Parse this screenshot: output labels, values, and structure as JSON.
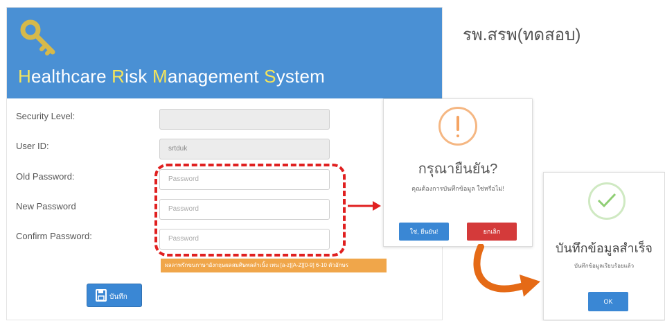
{
  "header": {
    "title_parts": [
      {
        "text": "H",
        "hl": true
      },
      {
        "text": "ealthcare ",
        "hl": false
      },
      {
        "text": "R",
        "hl": true
      },
      {
        "text": "isk ",
        "hl": false
      },
      {
        "text": "M",
        "hl": true
      },
      {
        "text": "anagement ",
        "hl": false
      },
      {
        "text": "S",
        "hl": true
      },
      {
        "text": "ystem",
        "hl": false
      }
    ]
  },
  "hospital_name": "รพ.สรพ(ทดสอบ)",
  "form": {
    "security_level": {
      "label": "Security Level:",
      "value": ""
    },
    "user_id": {
      "label": "User ID:",
      "value": "srtduk"
    },
    "old_password": {
      "label": "Old Password:",
      "placeholder": "Password"
    },
    "new_password": {
      "label": "New Password",
      "placeholder": "Password"
    },
    "confirm_password": {
      "label": "Confirm Password:",
      "placeholder": "Password"
    },
    "hint": "ผลลาพรักขนกาษาอังกฤษผลสมศิษพลสำเนิ้ง เพน [a-z][A-Z][0-9] 6-10 ตัวอักษร",
    "save_label": "บันทึก"
  },
  "confirm_dialog": {
    "title": "กรุณายืนยัน?",
    "message": "คุณต้องการบันทึกข้อมูล ใช่หรือไม่!",
    "yes_label": "ใช่, ยืนยัน!",
    "cancel_label": "ยกเลิก"
  },
  "success_dialog": {
    "title": "บันทึกข้อมูลสำเร็จ",
    "message": "บันทึกข้อมูลเรียบร้อยแล้ว",
    "ok_label": "OK"
  },
  "colors": {
    "header_bg": "#4a90d4",
    "title_highlight": "#f5e55a",
    "primary_button": "#3a87d4",
    "danger_button": "#d43a3a",
    "hint_bg": "#f0a64a",
    "dashed_highlight": "#e02020",
    "curved_arrow": "#e56a16"
  },
  "icons": [
    "key-icon",
    "floppy-disk-icon",
    "warning-icon",
    "checkmark-icon",
    "right-arrow-icon",
    "curved-arrow-icon"
  ]
}
